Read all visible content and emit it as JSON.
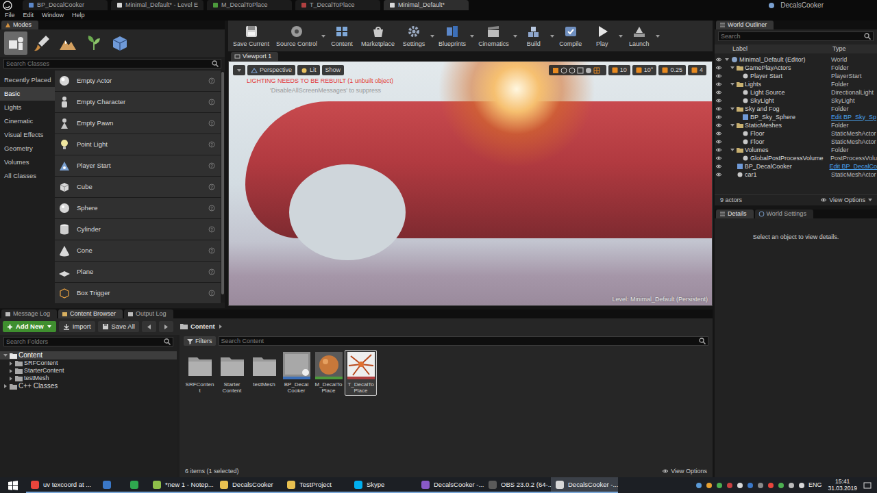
{
  "title_bar": {
    "tabs": [
      {
        "label": "BP_DecalCooker",
        "selected": false
      },
      {
        "label": "Minimal_Default* - Level E",
        "selected": false
      },
      {
        "label": "M_DecalToPlace",
        "selected": false
      },
      {
        "label": "T_DecalToPlace",
        "selected": false
      },
      {
        "label": "Minimal_Default*",
        "selected": true
      }
    ],
    "project": "DecalsCooker"
  },
  "menu": [
    "File",
    "Edit",
    "Window",
    "Help"
  ],
  "modes": {
    "tab": "Modes",
    "search": {
      "placeholder": "Search Classes"
    },
    "tools": [
      {
        "selected": true
      },
      {
        "selected": false
      },
      {
        "selected": false
      },
      {
        "selected": false
      },
      {
        "selected": false
      }
    ],
    "categories": [
      {
        "label": "Recently Placed",
        "selected": false
      },
      {
        "label": "Basic",
        "selected": true
      },
      {
        "label": "Lights",
        "selected": false
      },
      {
        "label": "Cinematic",
        "selected": false
      },
      {
        "label": "Visual Effects",
        "selected": false
      },
      {
        "label": "Geometry",
        "selected": false
      },
      {
        "label": "Volumes",
        "selected": false
      },
      {
        "label": "All Classes",
        "selected": false
      }
    ],
    "items": [
      "Empty Actor",
      "Empty Character",
      "Empty Pawn",
      "Point Light",
      "Player Start",
      "Cube",
      "Sphere",
      "Cylinder",
      "Cone",
      "Plane",
      "Box Trigger"
    ]
  },
  "toolbar": [
    {
      "label": "Save Current",
      "dropdown": false
    },
    {
      "label": "Source Control",
      "dropdown": true
    },
    {
      "label": "Content",
      "dropdown": false
    },
    {
      "label": "Marketplace",
      "dropdown": false
    },
    {
      "label": "Settings",
      "dropdown": true
    },
    {
      "label": "Blueprints",
      "dropdown": true
    },
    {
      "label": "Cinematics",
      "dropdown": true
    },
    {
      "label": "Build",
      "dropdown": true
    },
    {
      "label": "Compile",
      "dropdown": false
    },
    {
      "label": "Play",
      "dropdown": true
    },
    {
      "label": "Launch",
      "dropdown": true
    }
  ],
  "viewport": {
    "tab": "Viewport 1",
    "buttons": [
      "Perspective",
      "Lit",
      "Show"
    ],
    "warning": "LIGHTING NEEDS TO BE REBUILT (1 unbuilt object)",
    "hint": "'DisableAllScreenMessages' to suppress",
    "snaps": [
      "10",
      "10°",
      "0.25",
      "4"
    ],
    "level": "Level: Minimal_Default (Persistent)"
  },
  "outliner": {
    "tab": "World Outliner",
    "search": {
      "placeholder": "Search"
    },
    "columns": [
      "Label",
      "Type"
    ],
    "rows": [
      {
        "label": "Minimal_Default (Editor)",
        "type": "World",
        "depth": 0,
        "kind": "world"
      },
      {
        "label": "GamePlayActors",
        "type": "Folder",
        "depth": 1,
        "kind": "folder"
      },
      {
        "label": "Player Start",
        "type": "PlayerStart",
        "depth": 2,
        "kind": "actor"
      },
      {
        "label": "Lights",
        "type": "Folder",
        "depth": 1,
        "kind": "folder"
      },
      {
        "label": "Light Source",
        "type": "DirectionalLight",
        "depth": 2,
        "kind": "actor"
      },
      {
        "label": "SkyLight",
        "type": "SkyLight",
        "depth": 2,
        "kind": "actor"
      },
      {
        "label": "Sky and Fog",
        "type": "Folder",
        "depth": 1,
        "kind": "folder"
      },
      {
        "label": "BP_Sky_Sphere",
        "type": "Edit BP_Sky_Sp",
        "depth": 2,
        "kind": "blueprint"
      },
      {
        "label": "StaticMeshes",
        "type": "Folder",
        "depth": 1,
        "kind": "folder"
      },
      {
        "label": "Floor",
        "type": "StaticMeshActor",
        "depth": 2,
        "kind": "actor"
      },
      {
        "label": "Floor",
        "type": "StaticMeshActor",
        "depth": 2,
        "kind": "actor"
      },
      {
        "label": "Volumes",
        "type": "Folder",
        "depth": 1,
        "kind": "folder"
      },
      {
        "label": "GlobalPostProcessVolume",
        "type": "PostProcessVolu",
        "depth": 2,
        "kind": "actor"
      },
      {
        "label": "BP_DecalCooker",
        "type": "Edit BP_DecalCo",
        "depth": 1,
        "kind": "blueprint"
      },
      {
        "label": "car1",
        "type": "StaticMeshActor",
        "depth": 1,
        "kind": "actor"
      }
    ],
    "count": "9 actors",
    "view_options": "View Options"
  },
  "details": {
    "tabs": [
      {
        "label": "Details",
        "selected": true
      },
      {
        "label": "World Settings",
        "selected": false
      }
    ],
    "empty": "Select an object to view details."
  },
  "bottom_tabs": [
    {
      "label": "Message Log",
      "selected": false
    },
    {
      "label": "Content Browser",
      "selected": true
    },
    {
      "label": "Output Log",
      "selected": false
    }
  ],
  "content_browser": {
    "add_new": "Add New",
    "import": "Import",
    "save_all": "Save All",
    "path": "Content",
    "folder_search": {
      "placeholder": "Search Folders"
    },
    "folders": [
      {
        "label": "Content",
        "depth": 0,
        "selected": true,
        "expanded": true
      },
      {
        "label": "SRFContent",
        "depth": 1,
        "selected": false,
        "expanded": false
      },
      {
        "label": "StarterContent",
        "depth": 1,
        "selected": false,
        "expanded": false
      },
      {
        "label": "testMesh",
        "depth": 1,
        "selected": false,
        "expanded": false
      },
      {
        "label": "C++ Classes",
        "depth": 0,
        "selected": false,
        "expanded": false
      }
    ],
    "filters": "Filters",
    "asset_search": {
      "placeholder": "Search Content"
    },
    "assets": [
      {
        "label": "SRFContent",
        "kind": "folder",
        "selected": false
      },
      {
        "label": "Starter Content",
        "kind": "folder",
        "selected": false
      },
      {
        "label": "testMesh",
        "kind": "folder",
        "selected": false
      },
      {
        "label": "BP_Decal Cooker",
        "kind": "blueprint",
        "selected": false
      },
      {
        "label": "M_DecalTo Place",
        "kind": "material",
        "selected": false
      },
      {
        "label": "T_DecalTo Place",
        "kind": "texture",
        "selected": true
      }
    ],
    "status": "6 items (1 selected)",
    "view_options": "View Options"
  },
  "taskbar": {
    "apps": [
      {
        "kind": "labeled",
        "label": "uv texcoord at ...",
        "selected": false
      },
      {
        "kind": "icon",
        "selected": false
      },
      {
        "kind": "icon",
        "selected": false
      },
      {
        "kind": "labeled",
        "label": "*new 1 - Notep...",
        "selected": false
      },
      {
        "kind": "labeled",
        "label": "DecalsCooker",
        "selected": false
      },
      {
        "kind": "labeled",
        "label": "TestProject",
        "selected": false
      },
      {
        "kind": "labeled",
        "label": "Skype",
        "selected": false
      },
      {
        "kind": "labeled",
        "label": "DecalsCooker -...",
        "selected": false
      },
      {
        "kind": "labeled",
        "label": "OBS 23.0.2 (64-...",
        "selected": false
      },
      {
        "kind": "labeled",
        "label": "DecalsCooker -...",
        "selected": true
      }
    ],
    "lang": "ENG",
    "time": "15:41",
    "date": "31.03.2019"
  }
}
